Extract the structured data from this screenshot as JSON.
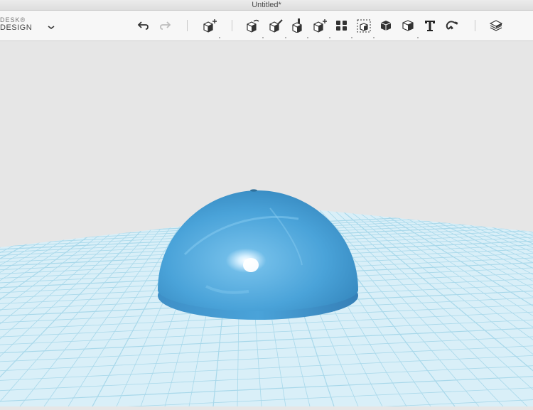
{
  "window": {
    "title": "Untitled*"
  },
  "brand": {
    "line1": "DESK",
    "line1_mark": "®",
    "line2": "DESIGN"
  },
  "toolbar": {
    "tools": [
      {
        "name": "undo-icon"
      },
      {
        "name": "redo-icon",
        "disabled": true
      },
      {
        "name": "add-primitive-icon"
      },
      {
        "name": "sketch-icon"
      },
      {
        "name": "construct-icon"
      },
      {
        "name": "modify-icon"
      },
      {
        "name": "combine-icon"
      },
      {
        "name": "pattern-icon"
      },
      {
        "name": "group-icon"
      },
      {
        "name": "solid-combine-icon"
      },
      {
        "name": "measure-icon"
      },
      {
        "name": "text-icon"
      },
      {
        "name": "snap-icon"
      },
      {
        "name": "material-icon"
      }
    ]
  },
  "scene": {
    "object": "hemisphere",
    "object_color": "#4aa3d9",
    "grid_color": "#a8d8ea",
    "grid_background": "#d9eff8",
    "viewport_background": "#e6e6e6"
  }
}
